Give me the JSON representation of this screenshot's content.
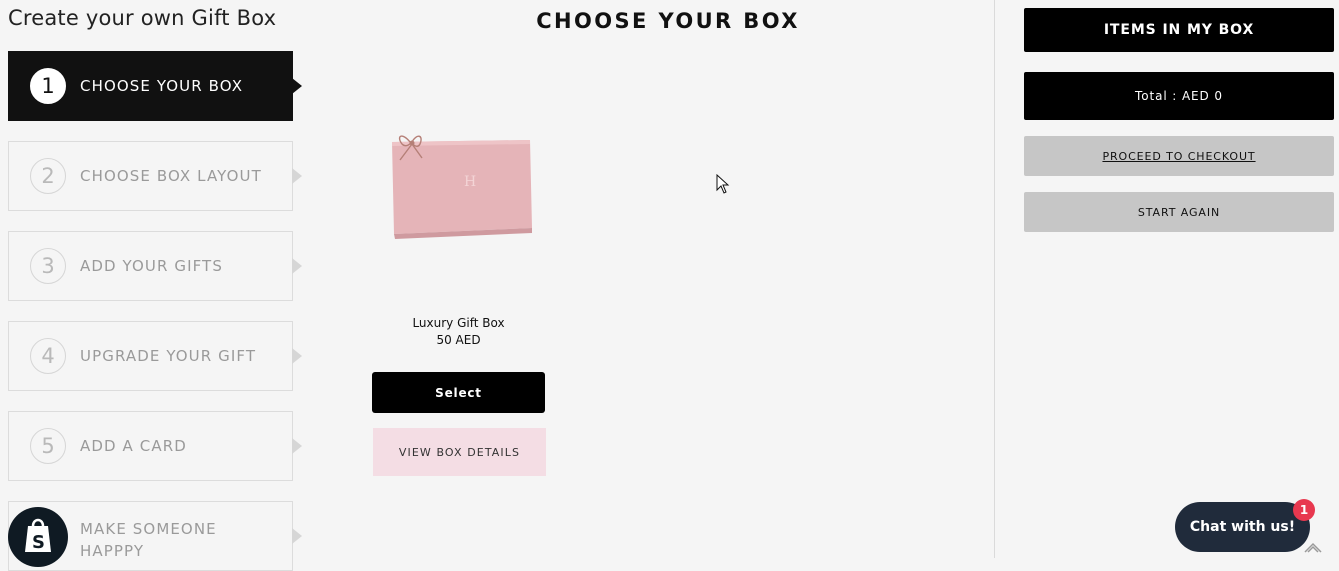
{
  "page": {
    "heading": "Create your own Gift Box"
  },
  "steps": [
    {
      "number": "1",
      "label": "CHOOSE YOUR BOX",
      "active": true
    },
    {
      "number": "2",
      "label": "CHOOSE BOX LAYOUT",
      "active": false
    },
    {
      "number": "3",
      "label": "ADD YOUR GIFTS",
      "active": false
    },
    {
      "number": "4",
      "label": "UPGRADE YOUR GIFT",
      "active": false
    },
    {
      "number": "5",
      "label": "ADD A CARD",
      "active": false
    },
    {
      "number": "",
      "label": "MAKE SOMEONE HAPPPY",
      "active": false
    }
  ],
  "main": {
    "title": "CHOOSE YOUR BOX",
    "product": {
      "name": "Luxury Gift Box",
      "price": "50 AED",
      "select_label": "Select",
      "details_label": "VIEW BOX DETAILS",
      "image_icon": "pink-gift-box-image"
    }
  },
  "sidebar": {
    "items_header": "ITEMS IN MY BOX",
    "total": "Total : AED 0",
    "checkout_label": "PROCEED TO CHECKOUT",
    "restart_label": "START AGAIN"
  },
  "widgets": {
    "chat_label": "Chat with us!",
    "chat_badge_count": "1",
    "shopify_icon": "shopify-bag-icon",
    "scroll_icon": "chevron-up-icon"
  },
  "colors": {
    "background": "#f5f5f5",
    "active_step": "#111111",
    "select_button": "#000000",
    "details_button": "#f4dde4",
    "gray_button": "#c6c6c6",
    "chat_button": "#202b3b",
    "chat_badge": "#e8384f",
    "gift_box": "#e5b4b8"
  }
}
